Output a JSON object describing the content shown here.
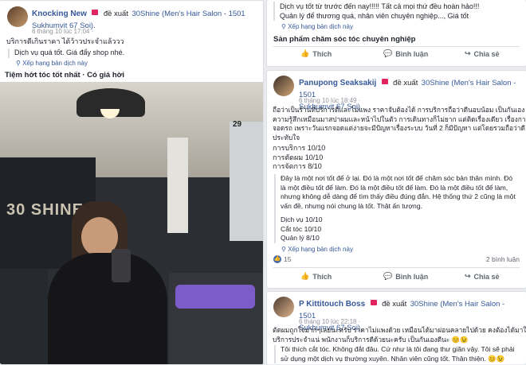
{
  "left": {
    "author": "Knocking New",
    "recommends": "đề xuất",
    "page": "30Shine (Men's Hair Salon - 1501",
    "page_line2": "Sukhumvit 67 Soi).",
    "time": "6 tháng 10 lúc 17:04 ·",
    "thai_text": "บริการดีเกินราคา ได้ว้าวประจำแล้ววว",
    "vn_text": "Dịch vụ quá tốt. Giá đẩy shop nhé.",
    "translate": "Xếp hạng bản dịch này",
    "caption": "Tiệm hớt tóc tốt nhất · Có giá hời",
    "photo_sign": "30 SHINE",
    "calendar_num": "29"
  },
  "top_right": {
    "line1": "Dịch vụ tốt từ trước đến nay!!!!! Tất cả mọi thứ đều hoàn hảo!!!",
    "line2": "Quản lý để thương quá, nhân viên chuyên nghiệp..., Giá tốt",
    "translate": "Xếp hạng bản dịch này",
    "product_line": "Sản phẩm chăm sóc tóc chuyên nghiệp",
    "like": "Thích",
    "comment": "Bình luận",
    "share": "Chia sẻ"
  },
  "mid_right": {
    "author": "Panupong Seaksakij",
    "recommends": "đề xuất",
    "page": "30Shine (Men's Hair Salon - 1501",
    "page_line2": "Sukhumvit 67 Soi).",
    "time": "6 tháng 10 lúc 18:49 ·",
    "thai_lines": [
      "ถือว่าเป็นร้านที่บริการดีและไม่แพง ราคาจับต้องได้ การบริการถือว่าดีนอบน้อม เป็นกันเอง ให้",
      "ความรู้สึกเหมือนมาสปาผมและหน้าไปในตัว การเดินทางก็ไม่ยาก แต่ติดเรื่องเดียว เรื่องการ",
      "จอดรถ เพราะวันแรกจอดแต่ง่ายจะมีปัญหาเรื่องระบบ วันที่ 2 ก็มีปัญหา แต่โดยรวมถือว่าดี",
      "ประทับใจ"
    ],
    "scores": [
      "การบริการ 10/10",
      "การตัดผม 10/10",
      "การจัดการ 8/10"
    ],
    "vn_lines": [
      "Đây là một nơi tốt để ở lại. Đó là một nơi tốt để chăm sóc bản thân mình. Đó",
      "là một điều tốt để làm. Đó là một điều tốt để làm. Đó là một điều tốt để làm,",
      "nhưng không dễ dàng để tìm thấy điều đúng đắn. Hệ thống thứ 2 cũng là một",
      "vấn đề, nhưng nói chung là tốt. Thật ấn tượng."
    ],
    "vn_scores": [
      "Dịch vụ 10/10",
      "Cắt tóc 10/10",
      "Quản lý 8/10"
    ],
    "translate": "Xếp hạng bản dịch này",
    "reactions": "15",
    "comments_count": "2 bình luận",
    "like": "Thích",
    "comment": "Bình luận",
    "share": "Chia sẻ"
  },
  "bottom_right": {
    "author": "P Kittitouch Boss",
    "recommends": "đề xuất",
    "page": "30Shine (Men's Hair Salon - 1501",
    "page_line2": "Sukhumvit 67 Soi).",
    "time": "6 tháng 10 lúc 22:18 ·",
    "thai_lines": [
      "ตัดผมถูกใจมากๆเลยนะครับ ราคาไม่แพงด้วย เหมือนได้มาผ่อนคลายไปด้วย คงต้องได้มาใช้",
      "บริการประจำแน่ พนักงานก็บริการดีด้วยนะครับ เป็นกันเองดีนะ 😊😉"
    ],
    "vn_lines": [
      "Tôi thích cắt tóc. Không đắt đâu. Cứ như là tôi đang thư giãn vậy. Tôi sẽ phải",
      "sử dụng một dịch vụ thường xuyên. Nhân viên cũng tốt. Thân thiện. 😊😉"
    ]
  },
  "colors": {
    "link": "#365899",
    "badge": "#e0245e",
    "bg": "#e9ebee"
  }
}
